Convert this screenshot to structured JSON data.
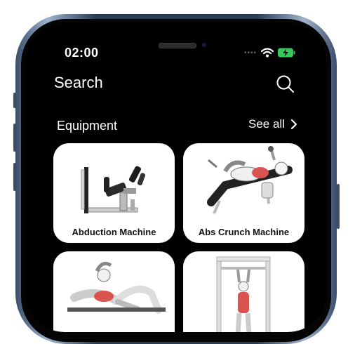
{
  "status_bar": {
    "time": "02:00"
  },
  "header": {
    "title": "Search"
  },
  "equipment": {
    "section_title": "Equipment",
    "see_all_label": "See all",
    "cards": [
      {
        "label": "Abduction Machine"
      },
      {
        "label": "Abs Crunch Machine"
      },
      {
        "label": ""
      },
      {
        "label": ""
      }
    ]
  },
  "icons": {
    "search": "search-icon",
    "chevron": "chevron-right-icon",
    "wifi": "wifi-icon",
    "battery": "battery-charging-icon"
  },
  "colors": {
    "screen_bg": "#000000",
    "card_bg": "#ffffff",
    "battery": "#34c759",
    "muscle_highlight": "#d9534f"
  }
}
